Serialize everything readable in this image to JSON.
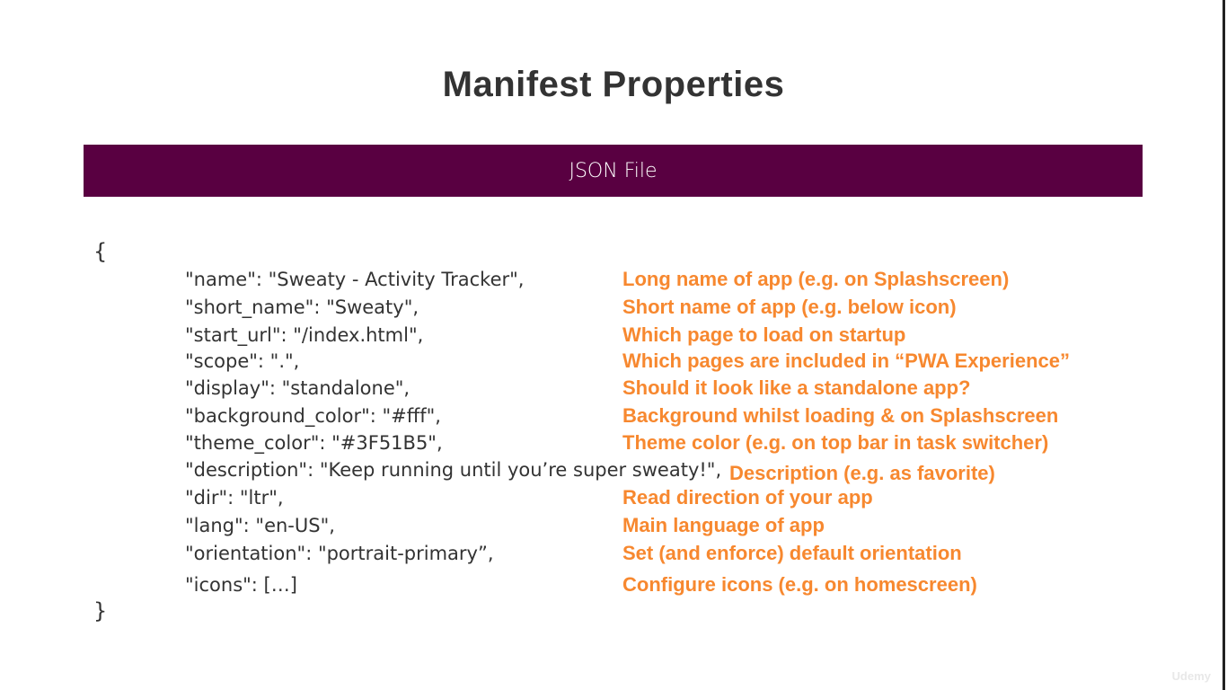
{
  "title": "Manifest Properties",
  "banner": "JSON File",
  "open_brace": "{",
  "close_brace": "}",
  "rows": [
    {
      "code": "\"name\": \"Sweaty - Activity Tracker\",",
      "note": "Long name of app (e.g. on Splashscreen)"
    },
    {
      "code": "\"short_name\": \"Sweaty\",",
      "note": "Short name of app (e.g. below icon)"
    },
    {
      "code": "\"start_url\": \"/index.html\",",
      "note": "Which page to load on startup"
    },
    {
      "code": "\"scope\": \".\",",
      "note": "Which pages are included in “PWA Experience”"
    },
    {
      "code": "\"display\": \"standalone\",",
      "note": "Should it look like a standalone app?"
    },
    {
      "code": "\"background_color\": \"#fff\",",
      "note": "Background whilst loading & on Splashscreen"
    },
    {
      "code": "\"theme_color\": \"#3F51B5\",",
      "note": "Theme color (e.g. on top bar in task switcher)"
    },
    {
      "code": "\"description\": \"Keep running until you’re super sweaty!\",",
      "note": "Description (e.g. as favorite)"
    },
    {
      "code": "\"dir\": \"ltr\",",
      "note": "Read direction of your app"
    },
    {
      "code": "\"lang\": \"en-US\",",
      "note": "Main language of app"
    },
    {
      "code": "\"orientation\": \"portrait-primary”,",
      "note": "Set (and enforce) default orientation"
    },
    {
      "code": "\"icons\": […]",
      "note": "Configure icons (e.g. on homescreen)"
    }
  ],
  "watermark": "Udemy",
  "colors": {
    "banner": "#590041",
    "note": "#f7882f",
    "text": "#333333"
  }
}
